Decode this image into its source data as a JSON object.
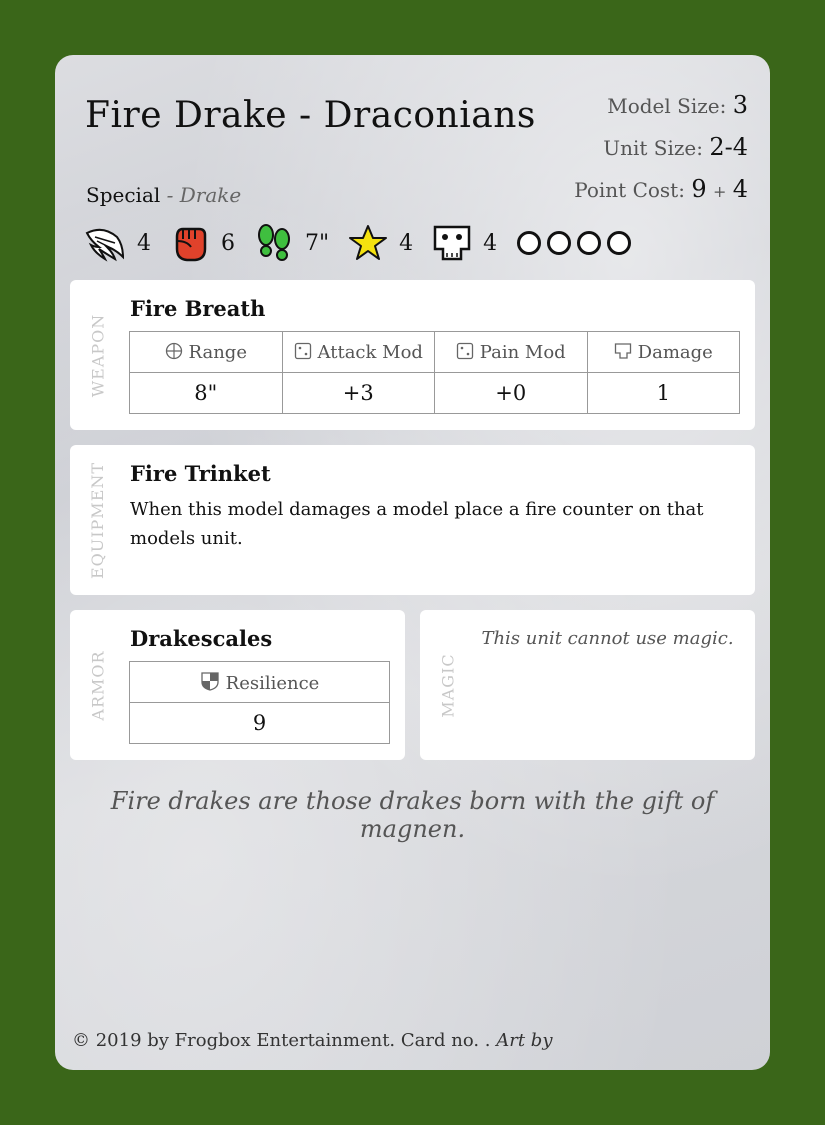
{
  "card": {
    "title": "Fire Drake - Draconians",
    "model_size_label": "Model Size:",
    "model_size": "3",
    "unit_size_label": "Unit Size:",
    "unit_size": "2-4",
    "point_cost_label": "Point Cost:",
    "point_cost_base": "9",
    "point_cost_plus": "+",
    "point_cost_extra": "4",
    "special_label": "Special",
    "special_sub": " - Drake",
    "attributes": [
      {
        "icon": "wing-icon",
        "value": "4"
      },
      {
        "icon": "fist-icon",
        "value": "6"
      },
      {
        "icon": "footprints-icon",
        "value": "7\""
      },
      {
        "icon": "star-icon",
        "value": "4"
      },
      {
        "icon": "skull-icon",
        "value": "4"
      }
    ],
    "wound_circles": 4,
    "colors": {
      "background": "#3a6619",
      "fist": "#e0422b",
      "footprints": "#3fbf3f",
      "star": "#f5e20f"
    }
  },
  "weapon": {
    "side_label": "WEAPON",
    "name": "Fire Breath",
    "headers": [
      "Range",
      "Attack Mod",
      "Pain Mod",
      "Damage"
    ],
    "values": [
      "8\"",
      "+3",
      "+0",
      "1"
    ]
  },
  "equipment": {
    "side_label": "EQUIPMENT",
    "name": "Fire Trinket",
    "text": "When this model damages a model place a fire counter on that models unit."
  },
  "armor": {
    "side_label": "ARMOR",
    "name": "Drakescales",
    "header": "Resilience",
    "value": "9"
  },
  "magic": {
    "side_label": "MAGIC",
    "text": "This unit cannot use magic."
  },
  "flavor": "Fire drakes are those drakes born with the gift of magnen.",
  "footer": {
    "text": "© 2019 by Frogbox Entertainment. Card no. . ",
    "art": "Art by"
  }
}
